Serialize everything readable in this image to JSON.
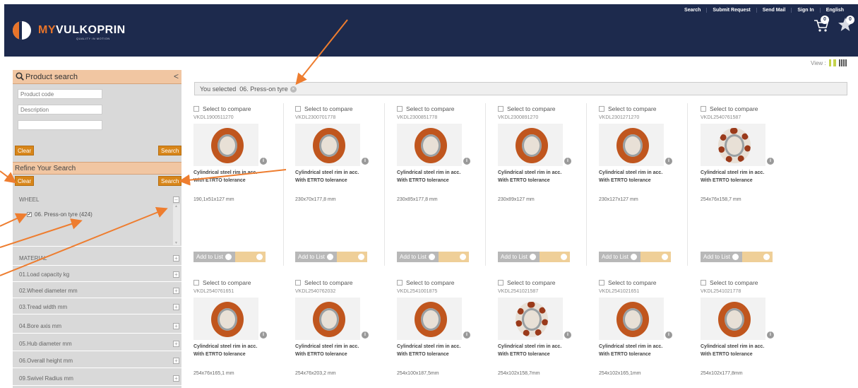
{
  "header": {
    "logo_my": "MY",
    "logo_name": "VULKOPRIN",
    "tagline": "QUALITY IN MOTION",
    "nav": [
      "Search",
      "Submit Request",
      "Send Mail",
      "Sign In",
      "English"
    ],
    "cart_count": "0",
    "favorites_count": "0"
  },
  "view": {
    "label": "View :"
  },
  "sidebar": {
    "product_search_title": "Product search",
    "collapse_glyph": "<",
    "product_code_placeholder": "Product code",
    "description_placeholder": "Description",
    "clear_label": "Clear",
    "search_label": "Search",
    "refine_title": "Refine Your Search",
    "refine_clear_label": "Clear",
    "refine_search_label": "Search",
    "wheel_label": "WHEEL",
    "wheel_option": "06. Press-on tyre (424)",
    "facets": [
      "MATERIAL",
      "01.Load capacity kg",
      "02.Wheel diameter mm",
      "03.Tread width mm",
      "04.Bore axis mm",
      "05.Hub diameter mm",
      "06.Overall height mm",
      "09.Swivel Radius mm"
    ]
  },
  "selection": {
    "prefix": "You selected",
    "value": "06. Press-on tyre"
  },
  "card_common": {
    "compare_label": "Select to compare",
    "desc_line1": "Cylindrical steel rim in acc.",
    "desc_line2": "With ETRTO tolerance",
    "add_label": "Add to List"
  },
  "products": [
    {
      "code": "VKDL1900511270",
      "size": "190,1x51x127 mm",
      "teeth": false
    },
    {
      "code": "VKDL2300701778",
      "size": "230x70x177,8 mm",
      "teeth": false
    },
    {
      "code": "VKDL2300851778",
      "size": "230x85x177,8 mm",
      "teeth": false
    },
    {
      "code": "VKDL2300891270",
      "size": "230x89x127 mm",
      "teeth": false
    },
    {
      "code": "VKDL2301271270",
      "size": "230x127x127 mm",
      "teeth": false
    },
    {
      "code": "VKDL2540761587",
      "size": "254x76x158,7 mm",
      "teeth": true
    },
    {
      "code": "VKDL2540761651",
      "size": "254x76x165,1 mm",
      "teeth": false
    },
    {
      "code": "VKDL2540762032",
      "size": "254x76x203,2 mm",
      "teeth": false
    },
    {
      "code": "VKDL2541001875",
      "size": "254x100x187,5mm",
      "teeth": false
    },
    {
      "code": "VKDL2541021587",
      "size": "254x102x158,7mm",
      "teeth": true
    },
    {
      "code": "VKDL2541021651",
      "size": "254x102x165,1mm",
      "teeth": false
    },
    {
      "code": "VKDL2541021778",
      "size": "254x102x177,8mm",
      "teeth": false
    }
  ],
  "colors": {
    "header_bg": "#1d2a4d",
    "accent_orange": "#e8742a",
    "panel_peach": "#f1c6a2",
    "button_orange": "#d8861a"
  }
}
